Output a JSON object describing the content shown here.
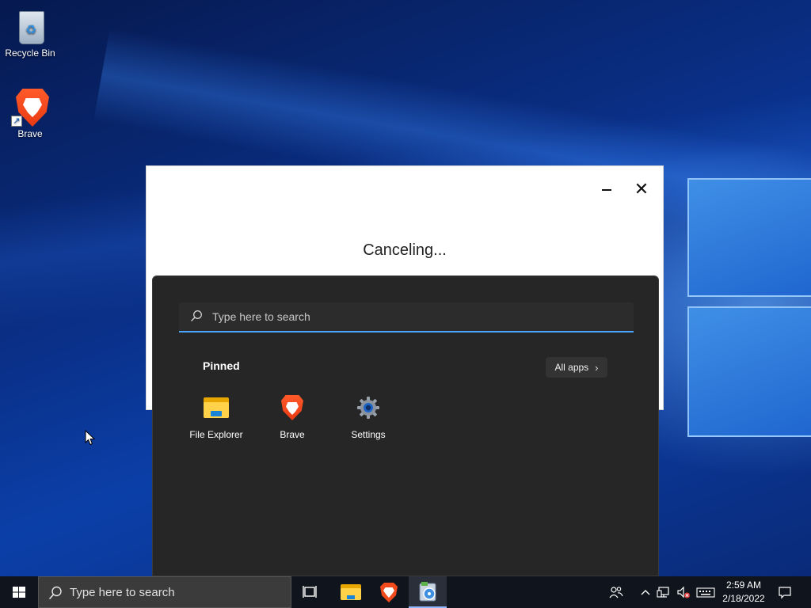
{
  "desktop": {
    "icons": [
      {
        "label": "Recycle Bin",
        "icon": "recycle-bin-icon"
      },
      {
        "label": "Brave",
        "icon": "brave-icon"
      }
    ]
  },
  "dialog": {
    "status": "Canceling...",
    "minimize_icon": "minimize-icon",
    "close_icon": "close-icon"
  },
  "start_menu": {
    "search_placeholder": "Type here to search",
    "pinned_label": "Pinned",
    "all_apps_label": "All apps",
    "pinned_apps": [
      {
        "label": "File Explorer",
        "icon": "file-explorer-icon"
      },
      {
        "label": "Brave",
        "icon": "brave-icon"
      },
      {
        "label": "Settings",
        "icon": "gear-icon"
      }
    ]
  },
  "taskbar": {
    "search_placeholder": "Type here to search",
    "time": "2:59 AM",
    "date": "2/18/2022",
    "apps": [
      "task-view-icon",
      "file-explorer-icon",
      "brave-icon",
      "installer-icon"
    ]
  },
  "colors": {
    "accent": "#4aa3ff",
    "start_bg": "#262626",
    "taskbar_bg": "#10141c",
    "brave_orange": "#fb542b"
  }
}
